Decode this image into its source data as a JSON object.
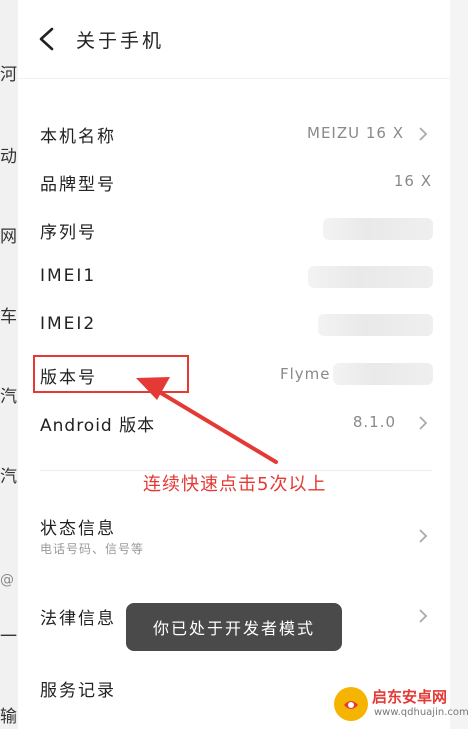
{
  "background_app": {
    "fragments": [
      "河",
      "动",
      "网",
      "车",
      "汽",
      "汽",
      "@",
      "一",
      "输"
    ]
  },
  "header": {
    "back_icon": "chevron-left-icon",
    "title": "关于手机"
  },
  "rows": [
    {
      "label": "本机名称",
      "value": "MEIZU 16 X",
      "chevron": true
    },
    {
      "label": "品牌型号",
      "value": "16 X",
      "chevron": false
    },
    {
      "label": "序列号",
      "value": "",
      "chevron": false
    },
    {
      "label": "IMEI1",
      "value": "",
      "chevron": false
    },
    {
      "label": "IMEI2",
      "value": "",
      "chevron": false
    },
    {
      "label": "版本号",
      "value": "Flyme",
      "chevron": false
    },
    {
      "label": "Android 版本",
      "value": "8.1.0",
      "chevron": true
    }
  ],
  "status_info": {
    "label": "状态信息",
    "sub": "电话号码、信号等"
  },
  "legal_info": {
    "label": "法律信息"
  },
  "service_record": {
    "label": "服务记录"
  },
  "annotation": {
    "text": "连续快速点击5次以上",
    "color": "#e53935"
  },
  "toast": {
    "text": "你已处于开发者模式"
  },
  "watermark": {
    "brand": "启东安卓网",
    "url": "www.qdhuajin.com"
  }
}
